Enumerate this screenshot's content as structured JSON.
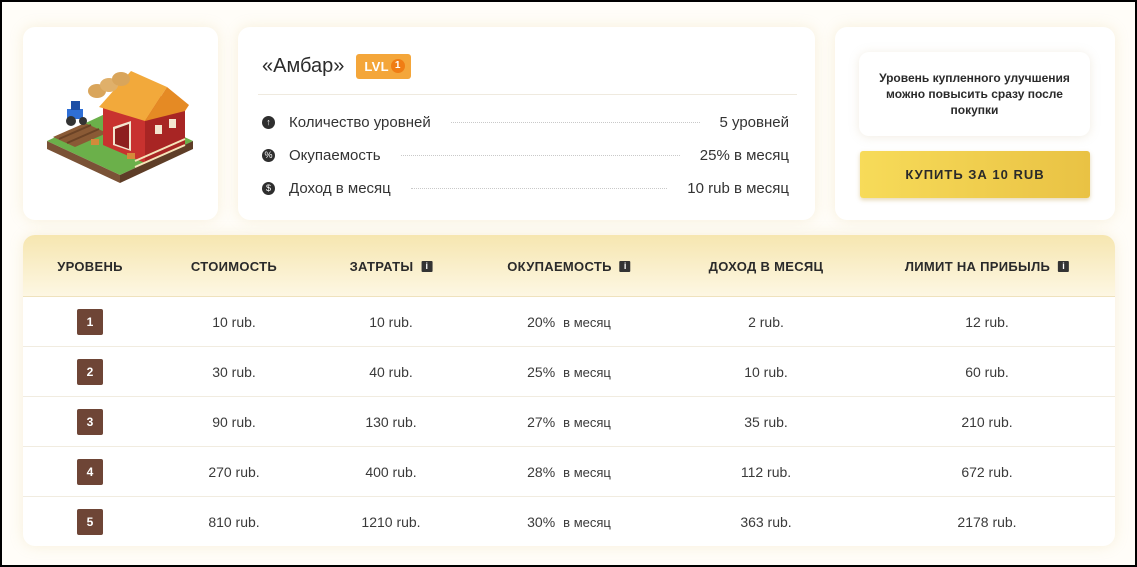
{
  "building": {
    "title": "«Амбар»",
    "level_badge": "LVL",
    "level_value": "1"
  },
  "stats": [
    {
      "icon": "arrow-up-icon",
      "label": "Количество уровней",
      "value": "5 уровней"
    },
    {
      "icon": "percent-icon",
      "label": "Окупаемость",
      "value": "25% в месяц"
    },
    {
      "icon": "coin-icon",
      "label": "Доход в месяц",
      "value": "10 rub в месяц"
    }
  ],
  "buy": {
    "note": "Уровень купленного улучшения можно повысить сразу после покупки",
    "button_label": "КУПИТЬ ЗА 10 RUB"
  },
  "table": {
    "headers": [
      "УРОВЕНЬ",
      "СТОИМОСТЬ",
      "ЗАТРАТЫ",
      "ОКУПАЕМОСТЬ",
      "ДОХОД В МЕСЯЦ",
      "ЛИМИТ НА ПРИБЫЛЬ"
    ],
    "per_month": "в месяц",
    "rows": [
      {
        "level": "1",
        "cost": "10 rub.",
        "expenses": "10 rub.",
        "payback": "20%",
        "income": "2 rub.",
        "limit": "12 rub."
      },
      {
        "level": "2",
        "cost": "30 rub.",
        "expenses": "40 rub.",
        "payback": "25%",
        "income": "10 rub.",
        "limit": "60 rub."
      },
      {
        "level": "3",
        "cost": "90 rub.",
        "expenses": "130 rub.",
        "payback": "27%",
        "income": "35 rub.",
        "limit": "210 rub."
      },
      {
        "level": "4",
        "cost": "270 rub.",
        "expenses": "400 rub.",
        "payback": "28%",
        "income": "112 rub.",
        "limit": "672 rub."
      },
      {
        "level": "5",
        "cost": "810 rub.",
        "expenses": "1210 rub.",
        "payback": "30%",
        "income": "363 rub.",
        "limit": "2178 rub."
      }
    ]
  },
  "colors": {
    "accent_orange": "#f4a63a",
    "button_yellow": "#f7db59",
    "level_brown": "#6e4536",
    "header_cream": "#f6e6b0"
  }
}
